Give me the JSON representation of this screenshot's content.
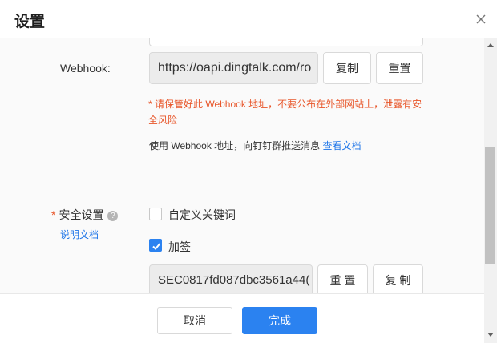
{
  "dialog": {
    "title": "设置"
  },
  "webhook": {
    "label": "Webhook:",
    "value": "https://oapi.dingtalk.com/ro",
    "copy_label": "复制",
    "reset_label": "重置",
    "warning": "* 请保管好此 Webhook 地址，不要公布在外部网站上，泄露有安全风险",
    "hint_text": "使用 Webhook 地址，向钉钉群推送消息",
    "hint_link": "查看文档"
  },
  "security": {
    "required_mark": "*",
    "label": "安全设置",
    "help_icon": "?",
    "doc_link": "说明文档",
    "options": [
      {
        "label": "自定义关键词",
        "checked": false
      },
      {
        "label": "加签",
        "checked": true
      }
    ],
    "secret_value": "SEC0817fd087dbc3561a44(",
    "reset_label": "重 置",
    "copy_label": "复 制"
  },
  "footer": {
    "cancel_label": "取消",
    "confirm_label": "完成"
  },
  "colors": {
    "primary": "#2b82f0",
    "warning": "#e8562a",
    "link": "#1a73e8"
  }
}
